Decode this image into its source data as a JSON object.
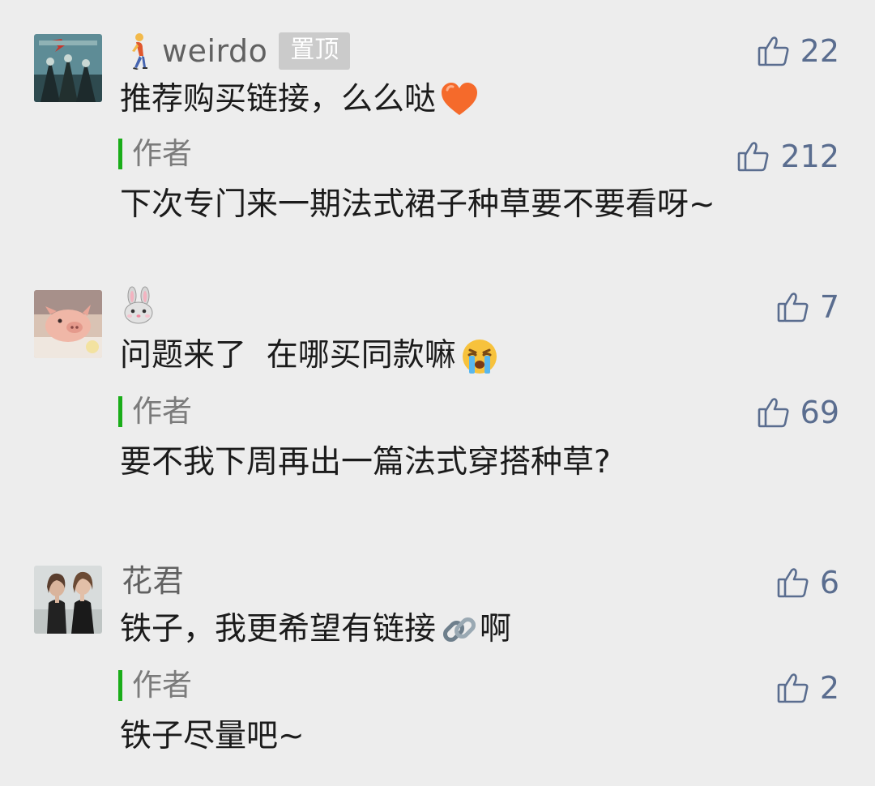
{
  "comments": [
    {
      "nickname": "weirdo",
      "nickname_emoji": "walking-person-icon",
      "badge": "置顶",
      "likes": "22",
      "text": "推荐购买链接，么么哒",
      "text_emoji": "orange-heart-icon",
      "reply": {
        "author_label": "作者",
        "likes": "212",
        "text": "下次专门来一期法式裙子种草要不要看呀~"
      }
    },
    {
      "nickname": "",
      "nickname_emoji": "rabbit-face-icon",
      "likes": "7",
      "text": "问题来了  在哪买同款嘛",
      "text_emoji": "crying-face-icon",
      "reply": {
        "author_label": "作者",
        "likes": "69",
        "text": "要不我下周再出一篇法式穿搭种草?"
      }
    },
    {
      "nickname": "花君",
      "likes": "6",
      "text_before": "铁子，我更希望有链接",
      "text_emoji": "link-icon",
      "text_after": "啊",
      "reply": {
        "author_label": "作者",
        "likes": "2",
        "text": "铁子尽量吧~"
      }
    }
  ],
  "colors": {
    "background": "#ededed",
    "nickname": "#616161",
    "like_count": "#5a6d8f",
    "author_bar": "#1aad19",
    "badge_bg": "#cbcbcb"
  }
}
